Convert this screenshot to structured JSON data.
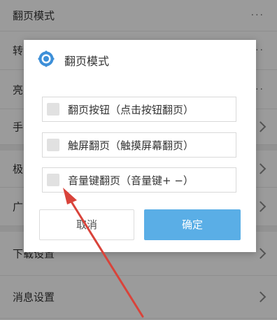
{
  "settings": {
    "rows": [
      {
        "label": "翻页模式",
        "trailing": "···"
      },
      {
        "label": "转",
        "trailing": "···"
      },
      {
        "label": "亮",
        "trailing": "···"
      },
      {
        "label": "手",
        "trailing": "chevron"
      },
      {
        "label": "极",
        "trailing": "chevron"
      },
      {
        "label": "广",
        "trailing": "chevron"
      },
      {
        "label": "下载设置",
        "trailing": "chevron"
      },
      {
        "label": "消息设置",
        "trailing": "chevron"
      }
    ]
  },
  "dialog": {
    "title": "翻页模式",
    "icon": "settings-gear-icon",
    "options": [
      {
        "label": "翻页按钮（点击按钮翻页）",
        "checked": false
      },
      {
        "label": "触屏翻页（触摸屏幕翻页）",
        "checked": false
      },
      {
        "label": "音量键翻页（音量键+ −）",
        "checked": false
      }
    ],
    "cancel_label": "取消",
    "confirm_label": "确定"
  },
  "colors": {
    "accent": "#5aaee6",
    "annotation_arrow": "#d9433a",
    "icon_blue": "#3d8fd8"
  }
}
